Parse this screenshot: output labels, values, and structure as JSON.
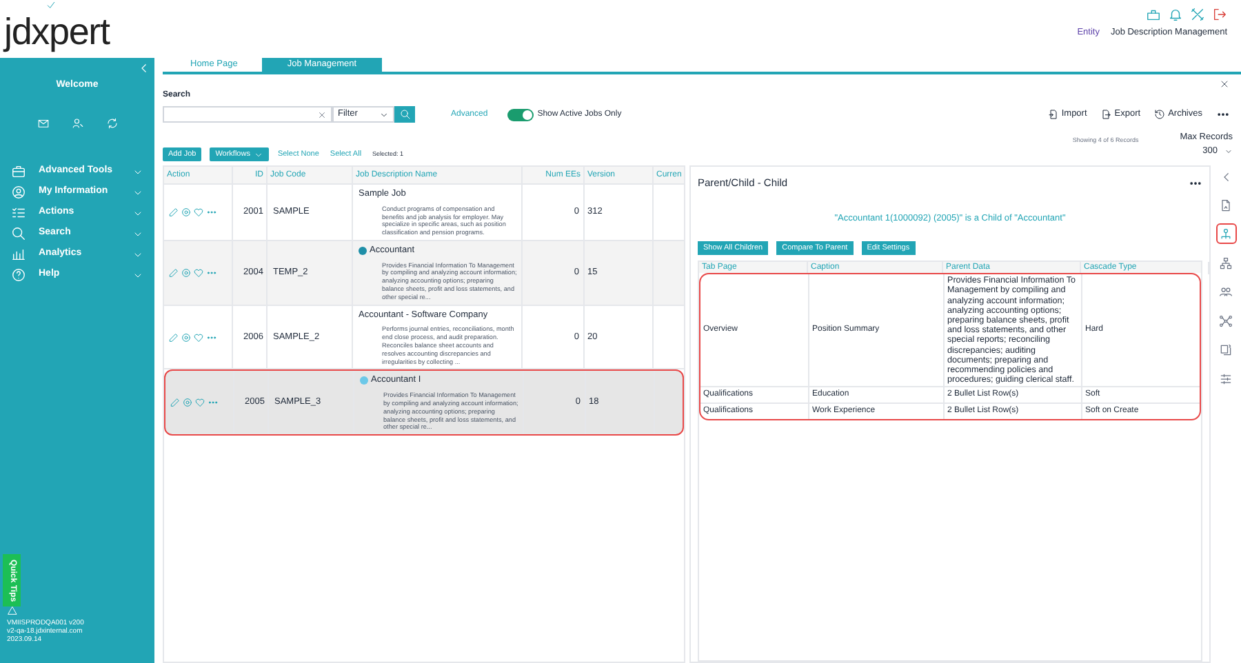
{
  "logo": {
    "text": "jdxpert"
  },
  "header": {
    "entity": "Entity",
    "module": "Job Description Management"
  },
  "sidebar": {
    "welcome": "Welcome",
    "menu": [
      {
        "label": "Advanced Tools",
        "kind": "briefcase"
      },
      {
        "label": "My Information",
        "kind": "person"
      },
      {
        "label": "Actions",
        "kind": "list"
      },
      {
        "label": "Search",
        "kind": "search"
      },
      {
        "label": "Analytics",
        "kind": "chart"
      },
      {
        "label": "Help",
        "kind": "help"
      }
    ],
    "quick_tips": "Quick Tips",
    "footer": [
      "VMIISPRODQA001 v200",
      "v2-qa-18.jdxinternal.com",
      "2023.09.14"
    ]
  },
  "tabs": [
    {
      "label": "Home Page",
      "selected": false
    },
    {
      "label": "Job Management",
      "selected": true
    }
  ],
  "search": {
    "label": "Search",
    "filter": "Filter",
    "advanced": "Advanced",
    "active_toggle": {
      "label": "Show Active Jobs Only",
      "on": true
    }
  },
  "actions": [
    {
      "label": "Import",
      "kind": "import"
    },
    {
      "label": "Export",
      "kind": "export"
    },
    {
      "label": "Archives",
      "kind": "history"
    }
  ],
  "records": {
    "showing": "Showing 4 of 6 Records",
    "max_label": "Max Records",
    "max_value": "300"
  },
  "toolbar": {
    "add": "Add Job",
    "workflows": "Workflows",
    "select_none": "Select None",
    "select_all": "Select All",
    "selected": "Selected: 1"
  },
  "jobs_table": {
    "columns": [
      "Action",
      "ID",
      "Job Code",
      "Job Description Name",
      "Num EEs",
      "Version",
      "Curren"
    ],
    "rows": [
      {
        "id": "2001",
        "code": "SAMPLE",
        "name": "Sample Job",
        "description": "Conduct programs of compensation and benefits and job analysis for employer. May specialize in specific areas, such as position classification and pension programs.",
        "num_ees": "0",
        "version": "312",
        "highlighted": false
      },
      {
        "id": "2004",
        "code": "TEMP_2",
        "name": "Accountant",
        "color": "#1f8fa8",
        "description": "Provides Financial Information To Management by compiling and analyzing account information; analyzing accounting options; preparing balance sheets, profit and loss statements, and other special re...",
        "num_ees": "0",
        "version": "15",
        "highlighted": false
      },
      {
        "id": "2006",
        "code": "SAMPLE_2",
        "name": "Accountant - Software Company",
        "description": "Performs journal entries, reconciliations, month end close process, and audit preparation.  Reconciles balance sheet accounts and resolves accounting discrepancies and irregularities by collecting ...",
        "num_ees": "0",
        "version": "20",
        "highlighted": false
      },
      {
        "id": "2005",
        "code": "SAMPLE_3",
        "name": "Accountant I",
        "color": "#6cc8e8",
        "description": "Provides Financial Information To Management by compiling and analyzing account information; analyzing accounting options; preparing balance sheets, profit and loss statements, and other special re...",
        "num_ees": "0",
        "version": "18",
        "highlighted": true
      }
    ]
  },
  "detail": {
    "title": "Parent/Child - Child",
    "relation": "\"Accountant 1(1000092) (2005)\" is a Child of \"Accountant\"",
    "buttons": [
      "Show All Children",
      "Compare To Parent",
      "Edit Settings"
    ],
    "columns": [
      "Tab Page",
      "Caption",
      "Parent Data",
      "Cascade Type"
    ],
    "highlighted": true,
    "rows": [
      {
        "tab_page": "Overview",
        "caption": "Position Summary",
        "parent_data": "Provides Financial Information To Management by compiling and analyzing account information; analyzing accounting options; preparing balance sheets, profit and loss statements, and other special reports; reconciling discrepancies; auditing documents; preparing and recommending policies and procedures; guiding clerical staff.",
        "cascade_type": "Hard"
      },
      {
        "tab_page": "Qualifications",
        "caption": "Education",
        "parent_data": "2 Bullet List Row(s)",
        "cascade_type": "Soft"
      },
      {
        "tab_page": "Qualifications",
        "caption": "Work Experience",
        "parent_data": "2 Bullet List Row(s)",
        "cascade_type": "Soft on Create"
      }
    ]
  },
  "rail": [
    {
      "kind": "document",
      "selected": false
    },
    {
      "kind": "hierarchy",
      "selected": true
    },
    {
      "kind": "org",
      "selected": false
    },
    {
      "kind": "group",
      "selected": false
    },
    {
      "kind": "network",
      "selected": false
    },
    {
      "kind": "compare",
      "selected": false
    },
    {
      "kind": "settings",
      "selected": false
    }
  ]
}
